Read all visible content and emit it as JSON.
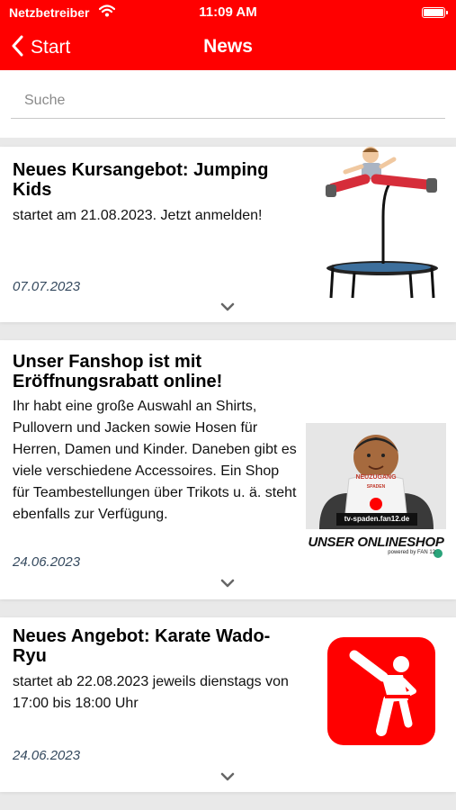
{
  "status": {
    "carrier": "Netzbetreiber",
    "time": "11:09 AM"
  },
  "nav": {
    "back_label": "Start",
    "title": "News"
  },
  "search": {
    "placeholder": "Suche"
  },
  "news": [
    {
      "title": "Neues Kursangebot: Jumping Kids",
      "text": "startet am 21.08.2023. Jetzt anmelden!",
      "date": "07.07.2023"
    },
    {
      "title": "Unser Fanshop ist mit Eröffnungsrabatt online!",
      "text": "Ihr habt eine große Auswahl an Shirts, Pullovern und Jacken sowie Hosen für Herren, Damen und Kinder. Daneben gibt es viele verschiedene Accessoires. Ein Shop für Teambestellungen über Trikots u. ä. steht ebenfalls zur Verfügung.",
      "date": "24.06.2023",
      "image_text": {
        "bib": "NEUZUGANG",
        "bib_sub": "SPADEN",
        "url": "tv-spaden.fan12.de",
        "headline": "UNSER ONLINESHOP",
        "powered": "powered by FAN 12"
      }
    },
    {
      "title": "Neues Angebot: Karate Wado-Ryu",
      "text": "startet ab 22.08.2023 jeweils dienstags von 17:00 bis 18:00 Uhr",
      "date": "24.06.2023"
    }
  ],
  "colors": {
    "brand": "#ff0000",
    "date": "#34495e",
    "background": "#e9e9e9"
  },
  "icons": [
    "wifi-icon",
    "battery-icon",
    "back-chevron-icon",
    "chevron-down-icon",
    "karate-icon"
  ]
}
